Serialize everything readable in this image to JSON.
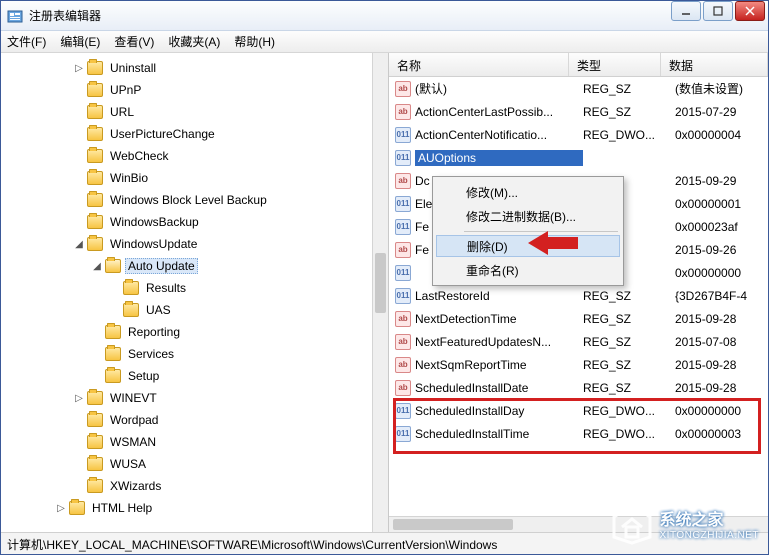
{
  "window": {
    "title": "注册表编辑器"
  },
  "menu": {
    "file": "文件(F)",
    "edit": "编辑(E)",
    "view": "查看(V)",
    "favorites": "收藏夹(A)",
    "help": "帮助(H)"
  },
  "tree": {
    "items": [
      {
        "indent": 4,
        "exp": "▷",
        "label": "Uninstall"
      },
      {
        "indent": 4,
        "exp": "",
        "label": "UPnP"
      },
      {
        "indent": 4,
        "exp": "",
        "label": "URL"
      },
      {
        "indent": 4,
        "exp": "",
        "label": "UserPictureChange"
      },
      {
        "indent": 4,
        "exp": "",
        "label": "WebCheck"
      },
      {
        "indent": 4,
        "exp": "",
        "label": "WinBio"
      },
      {
        "indent": 4,
        "exp": "",
        "label": "Windows Block Level Backup"
      },
      {
        "indent": 4,
        "exp": "",
        "label": "WindowsBackup"
      },
      {
        "indent": 4,
        "exp": "◢",
        "label": "WindowsUpdate"
      },
      {
        "indent": 5,
        "exp": "◢",
        "label": "Auto Update",
        "open": true,
        "sel": true
      },
      {
        "indent": 6,
        "exp": "",
        "label": "Results"
      },
      {
        "indent": 6,
        "exp": "",
        "label": "UAS"
      },
      {
        "indent": 5,
        "exp": "",
        "label": "Reporting"
      },
      {
        "indent": 5,
        "exp": "",
        "label": "Services"
      },
      {
        "indent": 5,
        "exp": "",
        "label": "Setup"
      },
      {
        "indent": 4,
        "exp": "▷",
        "label": "WINEVT"
      },
      {
        "indent": 4,
        "exp": "",
        "label": "Wordpad"
      },
      {
        "indent": 4,
        "exp": "",
        "label": "WSMAN"
      },
      {
        "indent": 4,
        "exp": "",
        "label": "WUSA"
      },
      {
        "indent": 4,
        "exp": "",
        "label": "XWizards"
      },
      {
        "indent": 3,
        "exp": "▷",
        "label": "HTML Help"
      }
    ]
  },
  "list": {
    "header": {
      "name": "名称",
      "type": "类型",
      "data": "数据"
    },
    "rows": [
      {
        "icon": "str",
        "name": "(默认)",
        "type": "REG_SZ",
        "data": "(数值未设置)"
      },
      {
        "icon": "str",
        "name": "ActionCenterLastPossib...",
        "type": "REG_SZ",
        "data": "2015-07-29"
      },
      {
        "icon": "bin",
        "name": "ActionCenterNotificatio...",
        "type": "REG_DWO...",
        "data": "0x00000004"
      },
      {
        "icon": "bin",
        "name": "AUOptions",
        "type": "",
        "data": "",
        "sel": true
      },
      {
        "icon": "str",
        "name": "Dc",
        "type": "",
        "data": "2015-09-29"
      },
      {
        "icon": "bin",
        "name": "Ele",
        "type": "",
        "data": "0x00000001"
      },
      {
        "icon": "bin",
        "name": "Fe",
        "type": "",
        "data": "0x000023af"
      },
      {
        "icon": "str",
        "name": "Fe",
        "type": "",
        "data": "2015-09-26"
      },
      {
        "icon": "bin",
        "name": "",
        "type": "",
        "data": "0x00000000"
      },
      {
        "icon": "bin",
        "name": "LastRestoreId",
        "type": "REG_SZ",
        "data": "{3D267B4F-4"
      },
      {
        "icon": "str",
        "name": "NextDetectionTime",
        "type": "REG_SZ",
        "data": "2015-09-28"
      },
      {
        "icon": "str",
        "name": "NextFeaturedUpdatesN...",
        "type": "REG_SZ",
        "data": "2015-07-08"
      },
      {
        "icon": "str",
        "name": "NextSqmReportTime",
        "type": "REG_SZ",
        "data": "2015-09-28"
      },
      {
        "icon": "str",
        "name": "ScheduledInstallDate",
        "type": "REG_SZ",
        "data": "2015-09-28"
      },
      {
        "icon": "bin",
        "name": "ScheduledInstallDay",
        "type": "REG_DWO...",
        "data": "0x00000000"
      },
      {
        "icon": "bin",
        "name": "ScheduledInstallTime",
        "type": "REG_DWO...",
        "data": "0x00000003"
      }
    ]
  },
  "context_menu": {
    "modify": "修改(M)...",
    "modify_binary": "修改二进制数据(B)...",
    "delete": "删除(D)",
    "rename": "重命名(R)"
  },
  "statusbar": {
    "path": "计算机\\HKEY_LOCAL_MACHINE\\SOFTWARE\\Microsoft\\Windows\\CurrentVersion\\Windows"
  },
  "watermark": {
    "title": "系统之家",
    "subtitle": "XITONGZHIJIA.NET"
  }
}
